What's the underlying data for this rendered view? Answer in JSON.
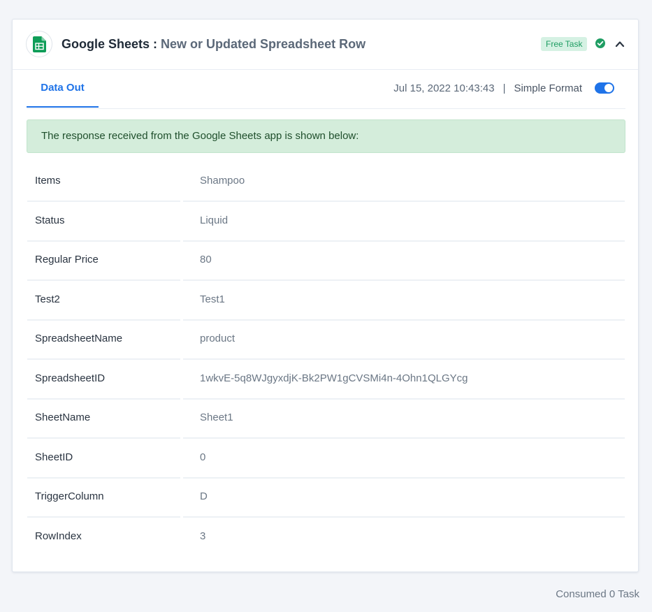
{
  "header": {
    "app_name": "Google Sheets",
    "separator": " : ",
    "trigger_name": "New or Updated Spreadsheet Row",
    "badge": "Free Task",
    "icons": {
      "app": "google-sheets-icon",
      "status": "check-circle-icon",
      "collapse": "chevron-up-icon"
    },
    "colors": {
      "sheets_green": "#0f9d58",
      "badge_bg": "#d5f1e3",
      "badge_text": "#1f9d63",
      "success": "#1f9d63"
    }
  },
  "tabs": [
    {
      "label": "Data Out",
      "active": true
    }
  ],
  "meta": {
    "timestamp": "Jul 15, 2022 10:43:43",
    "pipe": "|",
    "format_label": "Simple Format",
    "format_enabled": true,
    "accent": "#1f73e8"
  },
  "notice": {
    "text": "The response received from the Google Sheets app is shown below:",
    "bg": "#d4eddb"
  },
  "rows": [
    {
      "key": "Items",
      "value": "Shampoo"
    },
    {
      "key": "Status",
      "value": "Liquid"
    },
    {
      "key": "Regular Price",
      "value": "80"
    },
    {
      "key": "Test2",
      "value": "Test1"
    },
    {
      "key": "SpreadsheetName",
      "value": "product"
    },
    {
      "key": "SpreadsheetID",
      "value": "1wkvE-5q8WJgyxdjK-Bk2PW1gCVSMi4n-4Ohn1QLGYcg"
    },
    {
      "key": "SheetName",
      "value": "Sheet1"
    },
    {
      "key": "SheetID",
      "value": "0"
    },
    {
      "key": "TriggerColumn",
      "value": "D"
    },
    {
      "key": "RowIndex",
      "value": "3"
    }
  ],
  "footer": {
    "consumed": "Consumed 0 Task"
  }
}
